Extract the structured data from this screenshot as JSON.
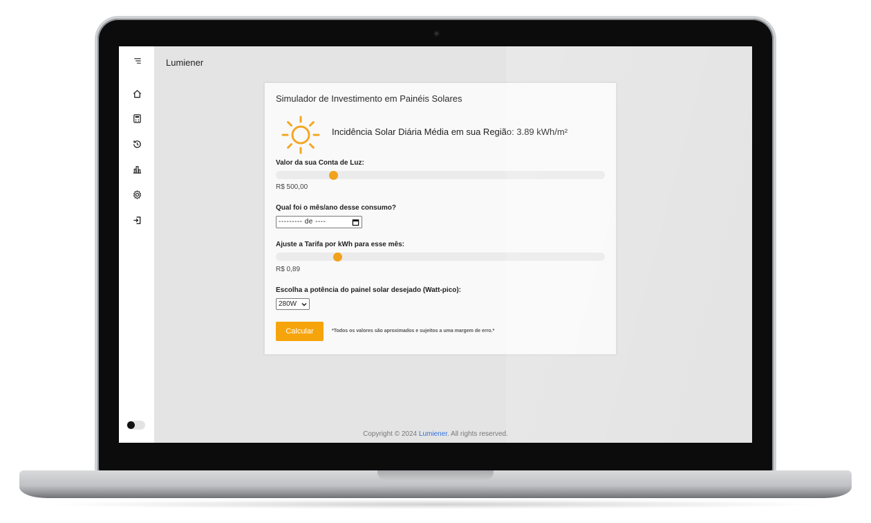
{
  "app": {
    "title": "Lumiener"
  },
  "sidebar": {
    "items": [
      {
        "icon": "menu-icon"
      },
      {
        "icon": "home-icon"
      },
      {
        "icon": "calculator-icon"
      },
      {
        "icon": "history-icon"
      },
      {
        "icon": "chart-icon"
      },
      {
        "icon": "gear-icon"
      },
      {
        "icon": "logout-icon"
      }
    ],
    "theme_toggle": {
      "state": "off"
    }
  },
  "simulator": {
    "title": "Simulador de Investimento em Painéis Solares",
    "irradiance_text": "Incidência Solar Diária Média em sua Região: 3.89 kWh/m²",
    "bill": {
      "label": "Valor da sua Conta de Luz:",
      "value_text": "R$ 500,00",
      "slider_fraction": 0.176
    },
    "month": {
      "label": "Qual foi o mês/ano desse consumo?",
      "placeholder": "--------- de ----"
    },
    "tariff": {
      "label": "Ajuste a Tarifa por kWh para esse mês:",
      "value_text": "R$ 0,89",
      "slider_fraction": 0.187
    },
    "panel": {
      "label": "Escolha a potência do painel solar desejado (Watt-pico):",
      "selected": "280W"
    },
    "calculate_label": "Calcular",
    "disclaimer": "*Todos os valores são aproximados e sujeitos a uma margem de erro.*"
  },
  "footer": {
    "prefix": "Copyright © 2024 ",
    "brand": "Lumiener",
    "suffix": ". All rights reserved."
  },
  "colors": {
    "accent": "#f6a40c",
    "slider_thumb": "#f1a21c",
    "sun": "#f5a623",
    "link": "#2f6fdb"
  }
}
